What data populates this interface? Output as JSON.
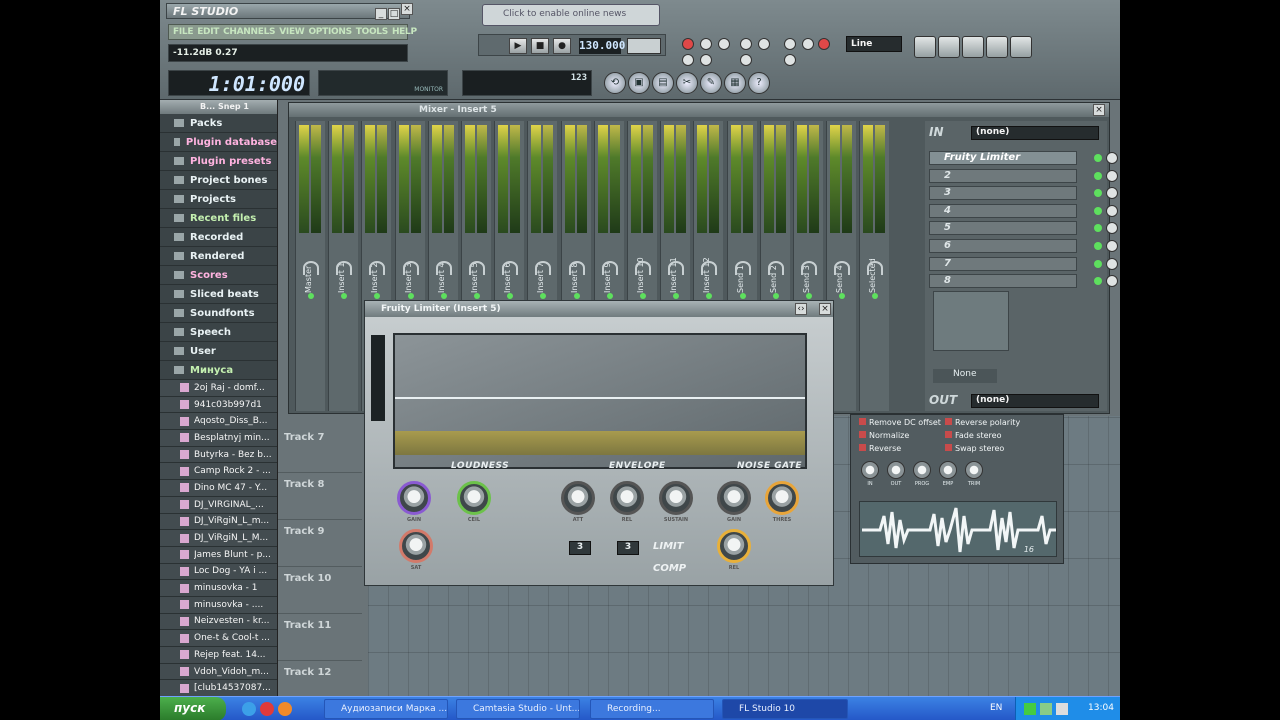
{
  "app": {
    "title": "FL STUDIO",
    "menu": [
      "FILE",
      "EDIT",
      "CHANNELS",
      "VIEW",
      "OPTIONS",
      "TOOLS",
      "HELP"
    ],
    "hint": "-11.2dB 0.27",
    "time": "1:01:000",
    "notification": "Click to enable online news",
    "bpm": "130.000",
    "snap": "Line",
    "cpu_label": "MONITOR",
    "poly_value": "123"
  },
  "browser": {
    "title": "B... Snep 1",
    "folders": [
      {
        "label": "Packs",
        "style": "normal"
      },
      {
        "label": "Plugin database",
        "style": "pink"
      },
      {
        "label": "Plugin presets",
        "style": "pink"
      },
      {
        "label": "Project bones",
        "style": "normal"
      },
      {
        "label": "Projects",
        "style": "normal"
      },
      {
        "label": "Recent files",
        "style": "green"
      },
      {
        "label": "Recorded",
        "style": "normal"
      },
      {
        "label": "Rendered",
        "style": "normal"
      },
      {
        "label": "Scores",
        "style": "pink"
      },
      {
        "label": "Sliced beats",
        "style": "normal"
      },
      {
        "label": "Soundfonts",
        "style": "normal"
      },
      {
        "label": "Speech",
        "style": "normal"
      },
      {
        "label": "User",
        "style": "normal"
      },
      {
        "label": "Минуса",
        "style": "green"
      }
    ],
    "files": [
      "2oj Raj - domf...",
      "941c03b997d1",
      "Aqosto_Diss_B...",
      "Besplatnyj min...",
      "Butyrka - Bez b...",
      "Camp Rock 2 - ...",
      "Dino MC 47 - Y...",
      "DJ_VIRGINAL_...",
      "DJ_ViRgiN_L_m...",
      "DJ_ViRgiN_L_M...",
      "James Blunt - p...",
      "Loc Dog - YA i ...",
      "minusovka - 1",
      "minusovka - ....",
      "Neizvesten - kr...",
      "One-t & Cool-t ...",
      "Rejep feat. 14...",
      "Vdoh_Vidoh_m...",
      "[club14537087..."
    ]
  },
  "playlist": {
    "tracks": [
      "Track 7",
      "Track 8",
      "Track 9",
      "Track 10",
      "Track 11",
      "Track 12"
    ]
  },
  "mixer": {
    "title": "Mixer - Insert 5",
    "strips": [
      "Master",
      "Insert 1",
      "Insert 2",
      "Insert 3",
      "Insert 4",
      "Insert 5",
      "Insert 6",
      "Insert 7",
      "Insert 8",
      "Insert 9",
      "Insert 10",
      "Insert 11",
      "Insert 12",
      "Send 1",
      "Send 2",
      "Send 3",
      "Send 4",
      "Selected"
    ],
    "in_label": "IN",
    "in_value": "(none)",
    "out_label": "OUT",
    "out_value": "(none)",
    "slots": [
      "Fruity Limiter",
      "2",
      "3",
      "4",
      "5",
      "6",
      "7",
      "8"
    ],
    "eq_preset": "None"
  },
  "limiter": {
    "title": "Fruity Limiter (Insert 5)",
    "sections": [
      "LOUDNESS",
      "ENVELOPE",
      "NOISE GATE"
    ],
    "knobs": [
      "GAIN",
      "CEIL",
      "ATT",
      "REL",
      "SUSTAIN",
      "GAIN",
      "THRES",
      "SAT",
      "REL"
    ],
    "box1": "3",
    "box2": "3",
    "modes": [
      "LIMIT",
      "COMP"
    ]
  },
  "sample": {
    "options": [
      "Remove DC offset",
      "Normalize",
      "Reverse",
      "Reverse polarity",
      "Fade stereo",
      "Swap stereo"
    ],
    "knobs": [
      "IN",
      "OUT",
      "PROG",
      "EMP",
      "TRIM"
    ],
    "counter": "16"
  },
  "taskbar": {
    "start": "пуск",
    "tasks": [
      "Аудиозаписи Марка ...",
      "Camtasia Studio - Unt...",
      "Recording...",
      "FL Studio 10"
    ],
    "lang": "EN",
    "clock": "13:04"
  }
}
